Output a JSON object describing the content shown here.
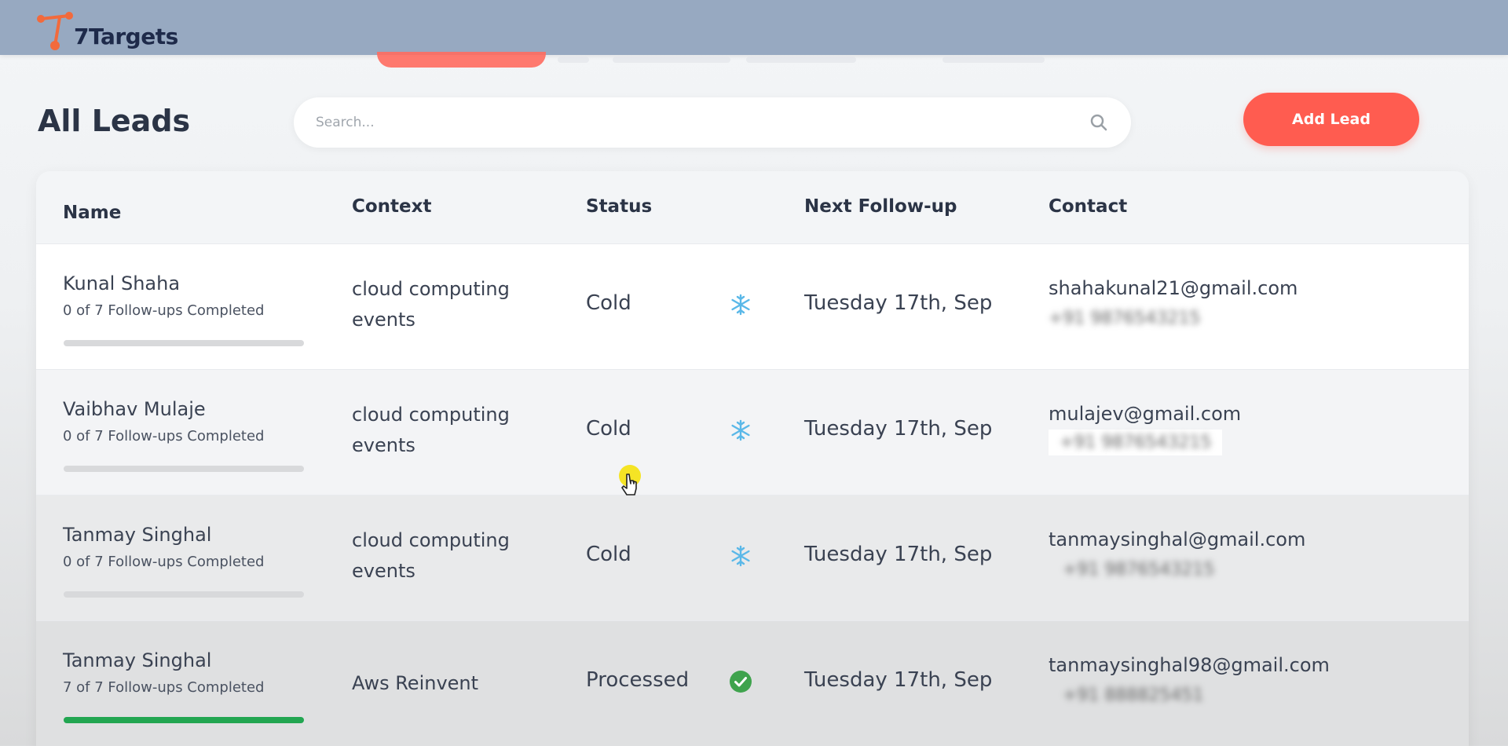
{
  "app": {
    "brand": "7Targets",
    "colors": {
      "topbar": "#97a9c1",
      "accent": "#ff5c50",
      "progress_done": "#22a651"
    }
  },
  "page": {
    "title": "All Leads"
  },
  "search": {
    "placeholder": "Search...",
    "icon": "search-icon"
  },
  "toolbar": {
    "add_label": "Add Lead"
  },
  "table": {
    "columns": [
      "Name",
      "Context",
      "Status",
      "Next Follow-up",
      "Contact"
    ],
    "rows": [
      {
        "name": "Kunal Shaha",
        "followups": "0 of 7 Follow-ups Completed",
        "progress": 0,
        "context": "cloud computing events",
        "status": "Cold",
        "status_icon": "snowflake-icon",
        "next_followup": "Tuesday 17th, Sep",
        "email": "shahakunal21@gmail.com",
        "phone": "+91 9876543215"
      },
      {
        "name": "Vaibhav Mulaje",
        "followups": "0 of 7 Follow-ups Completed",
        "progress": 0,
        "context": "cloud computing events",
        "status": "Cold",
        "status_icon": "snowflake-icon",
        "next_followup": "Tuesday 17th, Sep",
        "email": "mulajev@gmail.com",
        "phone": "+91 9876543215"
      },
      {
        "name": "Tanmay Singhal",
        "followups": "0 of 7 Follow-ups Completed",
        "progress": 0,
        "context": "cloud computing events",
        "status": "Cold",
        "status_icon": "snowflake-icon",
        "next_followup": "Tuesday 17th, Sep",
        "email": "tanmaysinghal@gmail.com",
        "phone": "+91 9876543215"
      },
      {
        "name": "Tanmay Singhal",
        "followups": "7 of 7 Follow-ups Completed",
        "progress": 1,
        "context": "Aws Reinvent",
        "status": "Processed",
        "status_icon": "check-circle-icon",
        "next_followup": "Tuesday 17th, Sep",
        "email": "tanmaysinghal98@gmail.com",
        "phone": "+91 888825451"
      }
    ]
  }
}
